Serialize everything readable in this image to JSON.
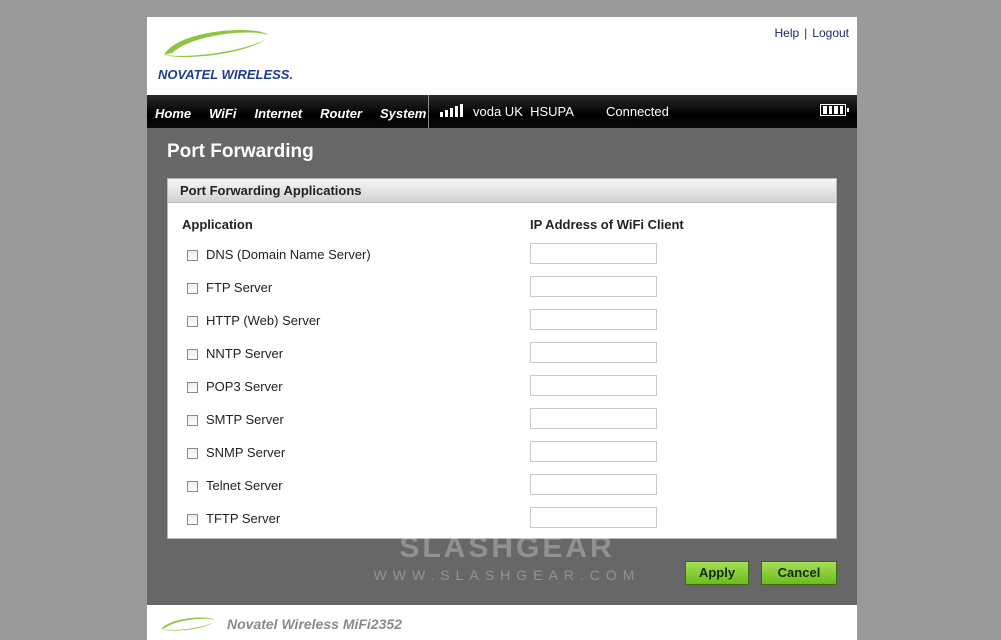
{
  "brand": {
    "logo_text": "NOVATEL WIRELESS.",
    "footer_text": "Novatel Wireless MiFi2352",
    "colors": {
      "logo_green": "#8cc63f",
      "logo_blue": "#1d3f8c",
      "button_green": "#7cc52a"
    }
  },
  "top_links": {
    "help": "Help",
    "separator": "|",
    "logout": "Logout"
  },
  "nav": {
    "items": [
      "Home",
      "WiFi",
      "Internet",
      "Router",
      "System"
    ],
    "carrier": "voda UK  HSUPA",
    "status": "Connected",
    "signal_icon": "signal-bars-icon",
    "battery_icon": "battery-icon"
  },
  "page": {
    "title": "Port Forwarding",
    "panel_title": "Port Forwarding Applications",
    "col_application": "Application",
    "col_ip": "IP Address of WiFi Client",
    "rows": [
      {
        "label": "DNS (Domain Name Server)",
        "checked": false,
        "ip": ""
      },
      {
        "label": "FTP Server",
        "checked": false,
        "ip": ""
      },
      {
        "label": "HTTP (Web) Server",
        "checked": false,
        "ip": ""
      },
      {
        "label": "NNTP Server",
        "checked": false,
        "ip": ""
      },
      {
        "label": "POP3 Server",
        "checked": false,
        "ip": ""
      },
      {
        "label": "SMTP Server",
        "checked": false,
        "ip": ""
      },
      {
        "label": "SNMP Server",
        "checked": false,
        "ip": ""
      },
      {
        "label": "Telnet Server",
        "checked": false,
        "ip": ""
      },
      {
        "label": "TFTP Server",
        "checked": false,
        "ip": ""
      }
    ]
  },
  "buttons": {
    "apply": "Apply",
    "cancel": "Cancel"
  },
  "watermark": {
    "line1": "SLASHGEAR",
    "line2": "WWW.SLASHGEAR.COM"
  }
}
